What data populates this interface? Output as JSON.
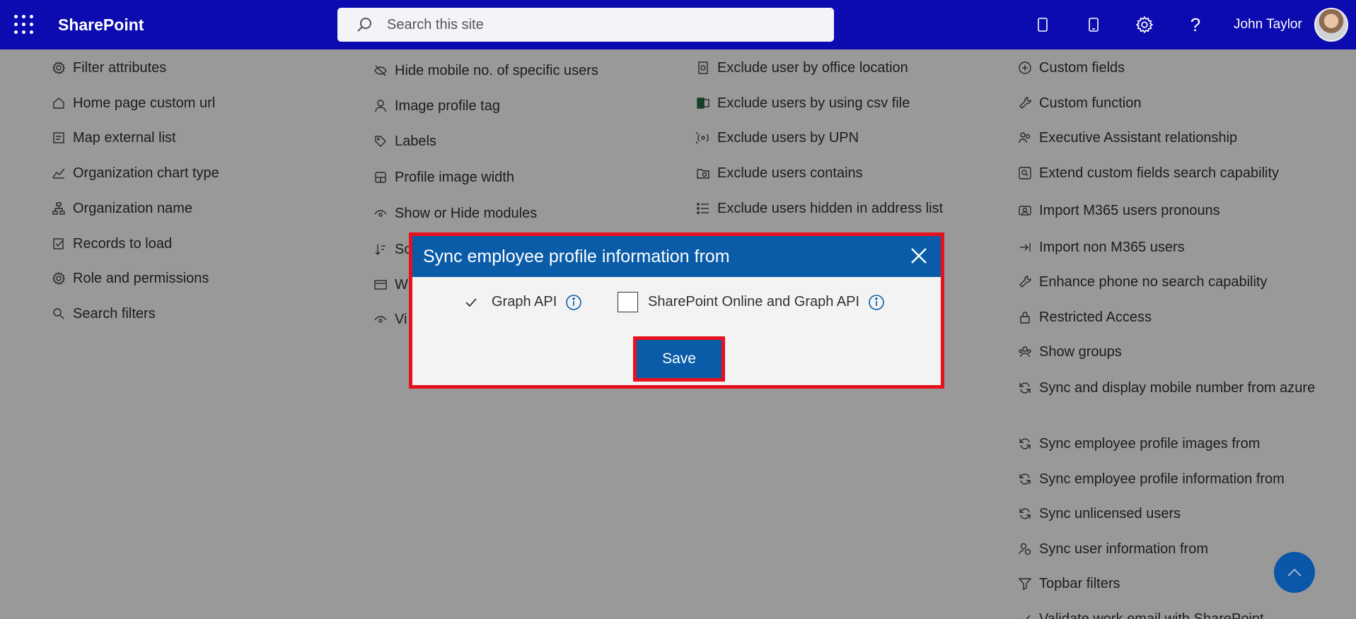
{
  "app": {
    "brand": "SharePoint",
    "search_placeholder": "Search this site",
    "user_name": "John Taylor"
  },
  "columns": {
    "col1": [
      {
        "label": "Filter attributes",
        "icon": "settings-gear-icon"
      },
      {
        "label": "Home page custom url",
        "icon": "home-icon"
      },
      {
        "label": "Map external list",
        "icon": "map-list-icon"
      },
      {
        "label": "Organization chart type",
        "icon": "chart-icon"
      },
      {
        "label": "Organization name",
        "icon": "org-tree-icon"
      },
      {
        "label": "Records to load",
        "icon": "records-check-icon"
      },
      {
        "label": "Role and permissions",
        "icon": "settings-gear-icon"
      },
      {
        "label": "Search filters",
        "icon": "search-icon"
      }
    ],
    "col2": [
      {
        "label": "Hide mobile no. of specific users",
        "icon": "eye-off-icon"
      },
      {
        "label": "Image profile tag",
        "icon": "person-icon"
      },
      {
        "label": "Labels",
        "icon": "tag-icon"
      },
      {
        "label": "Profile image width",
        "icon": "layout-icon"
      },
      {
        "label": "Show or Hide modules",
        "icon": "eye-icon"
      },
      {
        "label": "Sc",
        "icon": "sort-icon"
      },
      {
        "label": "W",
        "icon": "window-icon"
      },
      {
        "label": "Vi",
        "icon": "eye-icon"
      }
    ],
    "col3": [
      {
        "label": "Exclude user by office location",
        "icon": "office-icon"
      },
      {
        "label": "Exclude users by using csv file",
        "icon": "excel-icon"
      },
      {
        "label": "Exclude users by UPN",
        "icon": "signal-icon"
      },
      {
        "label": "Exclude users contains",
        "icon": "folder-search-icon"
      },
      {
        "label": "Exclude users hidden in address list",
        "icon": "list-icon"
      }
    ],
    "col4": [
      {
        "label": "Custom fields",
        "icon": "add-circle-icon"
      },
      {
        "label": "Custom function",
        "icon": "wrench-icon"
      },
      {
        "label": "Executive Assistant relationship",
        "icon": "people-icon"
      },
      {
        "label": "Extend custom fields search capability",
        "icon": "search-box-icon"
      },
      {
        "label": "Import M365 users pronouns",
        "icon": "contact-card-icon"
      },
      {
        "label": "Import non M365 users",
        "icon": "import-icon"
      },
      {
        "label": "Enhance phone no search capability",
        "icon": "wrench-icon"
      },
      {
        "label": "Restricted Access",
        "icon": "lock-icon"
      },
      {
        "label": "Show groups",
        "icon": "group-icon"
      },
      {
        "label": "Sync and display mobile number from azure",
        "icon": "sync-icon"
      },
      {
        "label": "Sync employee profile images from",
        "icon": "sync-icon"
      },
      {
        "label": "Sync employee profile information from",
        "icon": "sync-icon"
      },
      {
        "label": "Sync unlicensed users",
        "icon": "sync-icon"
      },
      {
        "label": "Sync user information from",
        "icon": "person-sync-icon"
      },
      {
        "label": "Topbar filters",
        "icon": "filter-icon"
      },
      {
        "label": "Validate work email with SharePoint",
        "icon": "check-icon"
      }
    ]
  },
  "dialog": {
    "title": "Sync employee profile information from",
    "options": [
      {
        "label": "Graph API",
        "checked": true
      },
      {
        "label": "SharePoint Online and Graph API",
        "checked": false
      }
    ],
    "save_label": "Save"
  },
  "colors": {
    "topbar": "#0b0bb0",
    "dialog_header": "#0a5ca8",
    "highlight": "#e8101c"
  }
}
